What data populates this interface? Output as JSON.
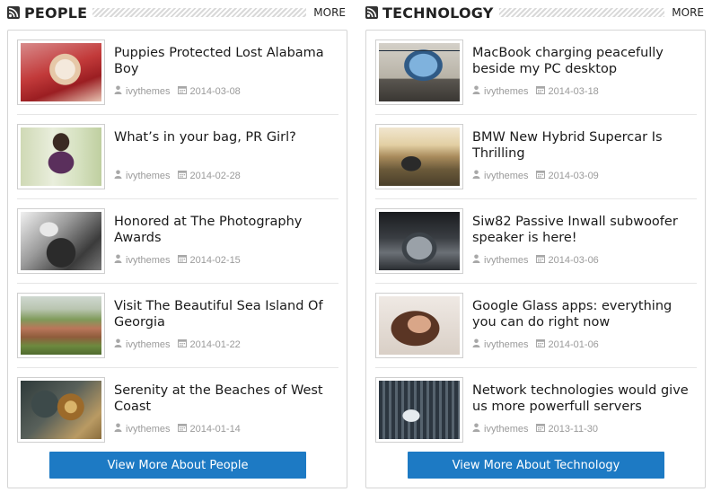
{
  "colors": {
    "accent": "#1d7ac4",
    "meta": "#9a9a9a",
    "border": "#d5d5d5"
  },
  "people": {
    "title": "PEOPLE",
    "more_label": "MORE",
    "view_more_label": "View More About People",
    "items": [
      {
        "title": "Puppies Protected Lost Alabama Boy",
        "author": "ivythemes",
        "date": "2014-03-08",
        "thumb_icon": "puppy-photo"
      },
      {
        "title": "What’s in your bag, PR Girl?",
        "author": "ivythemes",
        "date": "2014-02-28",
        "thumb_icon": "woman-fashion-photo"
      },
      {
        "title": "Honored at The Photography Awards",
        "author": "ivythemes",
        "date": "2014-02-15",
        "thumb_icon": "guitarist-bw-photo"
      },
      {
        "title": "Visit The Beautiful Sea Island Of Georgia",
        "author": "ivythemes",
        "date": "2014-01-22",
        "thumb_icon": "village-landscape-photo"
      },
      {
        "title": "Serenity at the Beaches of West Coast",
        "author": "ivythemes",
        "date": "2014-01-14",
        "thumb_icon": "gas-mask-photo"
      }
    ]
  },
  "technology": {
    "title": "TECHNOLOGY",
    "more_label": "MORE",
    "view_more_label": "View More About Technology",
    "items": [
      {
        "title": "MacBook charging peacefully beside my PC desktop",
        "author": "ivythemes",
        "date": "2014-03-18",
        "thumb_icon": "desktop-computer-photo"
      },
      {
        "title": "BMW New Hybrid Supercar Is Thrilling",
        "author": "ivythemes",
        "date": "2014-03-09",
        "thumb_icon": "suv-car-photo"
      },
      {
        "title": "Siw82 Passive Inwall subwoofer speaker is here!",
        "author": "ivythemes",
        "date": "2014-03-06",
        "thumb_icon": "sports-car-photo"
      },
      {
        "title": "Google Glass apps: everything you can do right now",
        "author": "ivythemes",
        "date": "2014-01-06",
        "thumb_icon": "google-glass-photo"
      },
      {
        "title": "Network technologies would give us more powerfull servers",
        "author": "ivythemes",
        "date": "2013-11-30",
        "thumb_icon": "server-room-photo"
      }
    ]
  }
}
